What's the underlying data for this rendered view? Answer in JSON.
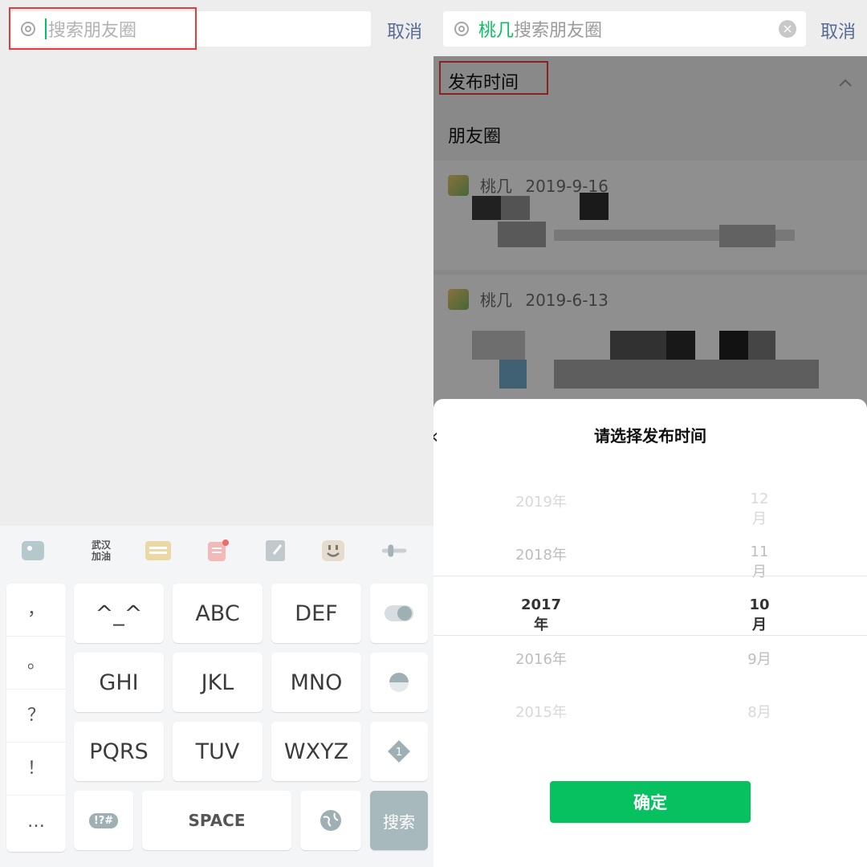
{
  "left": {
    "search": {
      "placeholder": "搜索朋友圈",
      "cancel": "取消"
    },
    "keyboard": {
      "toolbar_icons": [
        "puzzle-icon",
        "handwriting-icon",
        "keyboard-icon",
        "clipboard-icon",
        "edit-icon",
        "emoji-icon",
        "toggle-icon"
      ],
      "toolbar_text": "武汉加油",
      "punctuation": [
        "，",
        "。",
        "？",
        "！",
        "…"
      ],
      "rows": [
        [
          "^_^",
          "ABC",
          "DEF"
        ],
        [
          "GHI",
          "JKL",
          "MNO"
        ],
        [
          "PQRS",
          "TUV",
          "WXYZ"
        ]
      ],
      "symbols_key": "!?#",
      "space": "SPACE",
      "search_key": "搜索",
      "number_badge": "1"
    }
  },
  "right": {
    "search": {
      "query_highlight": "桃几",
      "query_rest": "搜索朋友圈",
      "cancel": "取消"
    },
    "section_publish_time": "发布时间",
    "section_moments": "朋友圈",
    "posts": [
      {
        "author": "桃几",
        "date": "2019-9-16"
      },
      {
        "author": "桃几",
        "date": "2019-6-13"
      }
    ],
    "modal": {
      "title": "请选择发布时间",
      "years": [
        "2019年",
        "2018年",
        "2017年",
        "2016年",
        "2015年"
      ],
      "months": [
        "12月",
        "11月",
        "10月",
        "9月",
        "8月"
      ],
      "selected_year": "2017年",
      "selected_month": "10月",
      "confirm": "确定"
    }
  },
  "colors": {
    "accent": "#07c160",
    "link": "#576b95",
    "highlight_box": "#e53b3b"
  }
}
